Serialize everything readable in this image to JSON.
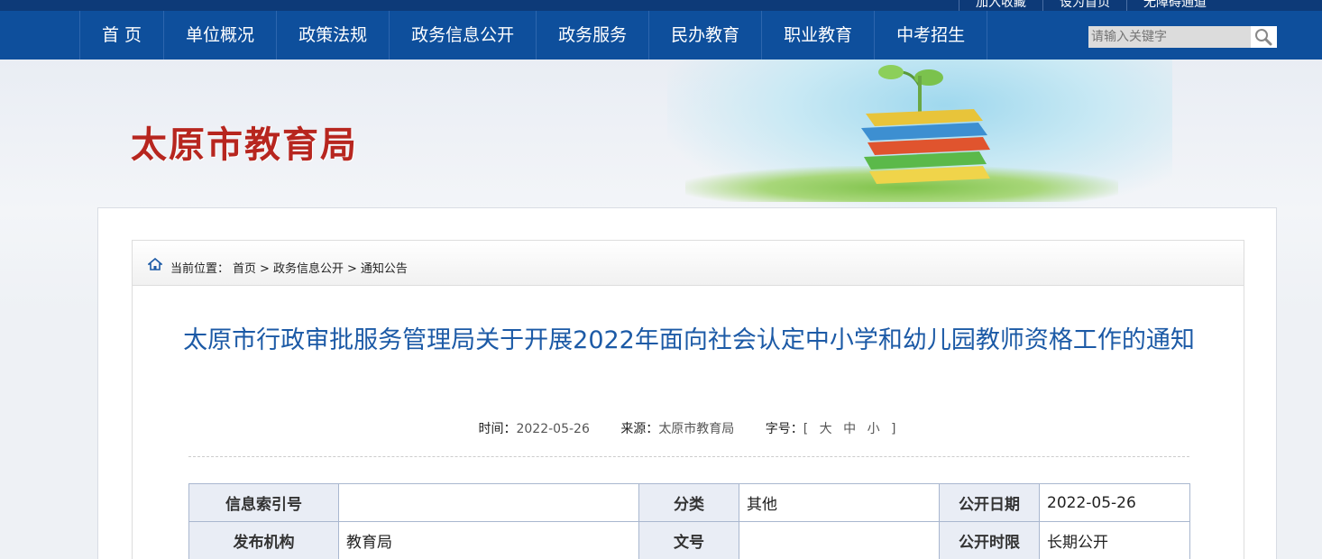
{
  "topbar": {
    "links": [
      "加入收藏",
      "设为首页",
      "无障碍通道"
    ]
  },
  "nav": {
    "items": [
      "首 页",
      "单位概况",
      "政策法规",
      "政务信息公开",
      "政务服务",
      "民办教育",
      "职业教育",
      "中考招生"
    ],
    "search_placeholder": "请输入关键字"
  },
  "banner": {
    "site_title": "太原市教育局"
  },
  "breadcrumb": {
    "label": "当前位置：",
    "items": [
      "首页",
      ">",
      "政务信息公开",
      ">",
      "通知公告"
    ]
  },
  "article": {
    "title": "太原市行政审批服务管理局关于开展2022年面向社会认定中小学和幼儿园教师资格工作的通知",
    "meta": {
      "time_label": "时间：",
      "time_value": "2022-05-26",
      "source_label": "来源：",
      "source_value": "太原市教育局",
      "size_label": "字号：",
      "size_options": "[ 大 中 小 ]"
    }
  },
  "info_table": {
    "rows": [
      [
        "信息索引号",
        "",
        "分类",
        "其他",
        "公开日期",
        "2022-05-26"
      ],
      [
        "发布机构",
        "教育局",
        "文号",
        "",
        "公开时限",
        "长期公开"
      ]
    ]
  }
}
